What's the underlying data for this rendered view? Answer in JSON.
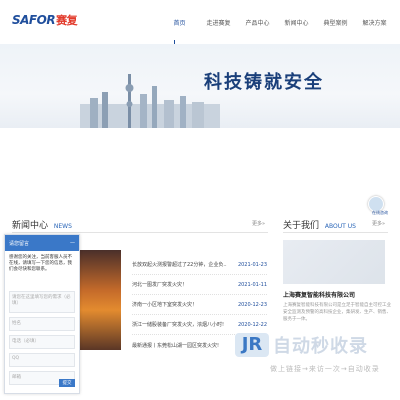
{
  "header": {
    "logo_en": "SAFOR",
    "logo_cn": "赛复",
    "nav": [
      "首页",
      "走进赛复",
      "产品中心",
      "新闻中心",
      "典型案例",
      "解决方案"
    ]
  },
  "banner": {
    "slogan": "科技铸就安全"
  },
  "chat_float": {
    "label": "在线咨询"
  },
  "news": {
    "title_cn": "新闻中心",
    "title_en": "NEWS",
    "more": "更多»",
    "items": [
      {
        "title": "长放双起火测报警超过了22分钟，企业负...",
        "date": "2021-01-23"
      },
      {
        "title": "河北一图发厂突发火灾！",
        "date": "2021-01-11"
      },
      {
        "title": "济南一小区地下室突发火灾！",
        "date": "2020-12-23"
      },
      {
        "title": "浙江一储股装备厂突发火灾，浓烟八小时!",
        "date": "2020-12-22"
      },
      {
        "title": "最新通报丨东莞松山湖一园区突发火灾!",
        "date": ""
      }
    ]
  },
  "about": {
    "title_cn": "关于我们",
    "title_en": "ABOUT US",
    "more": "更多»",
    "company": "上海赛复智能科技有限公司",
    "desc": "上海赛复智能科技有限公司是立足于智能自主可控工业安全监测及预警的高科技企业，集研发、生产、销售、服务于一体。"
  },
  "watermark": {
    "logo": "JR",
    "text": "自动秒收录",
    "sub": "做上链接→来访一次→自动收录"
  },
  "chat_panel": {
    "header": "请您留言",
    "message": "感谢您的关注，当前客服人员不在线，请填写一下您的信息，我们会尽快和您联系。",
    "placeholders": [
      "请您在这里填写您的需求（必填）",
      "姓名",
      "电话（必填）",
      "QQ",
      "邮箱"
    ],
    "submit": "提交"
  }
}
